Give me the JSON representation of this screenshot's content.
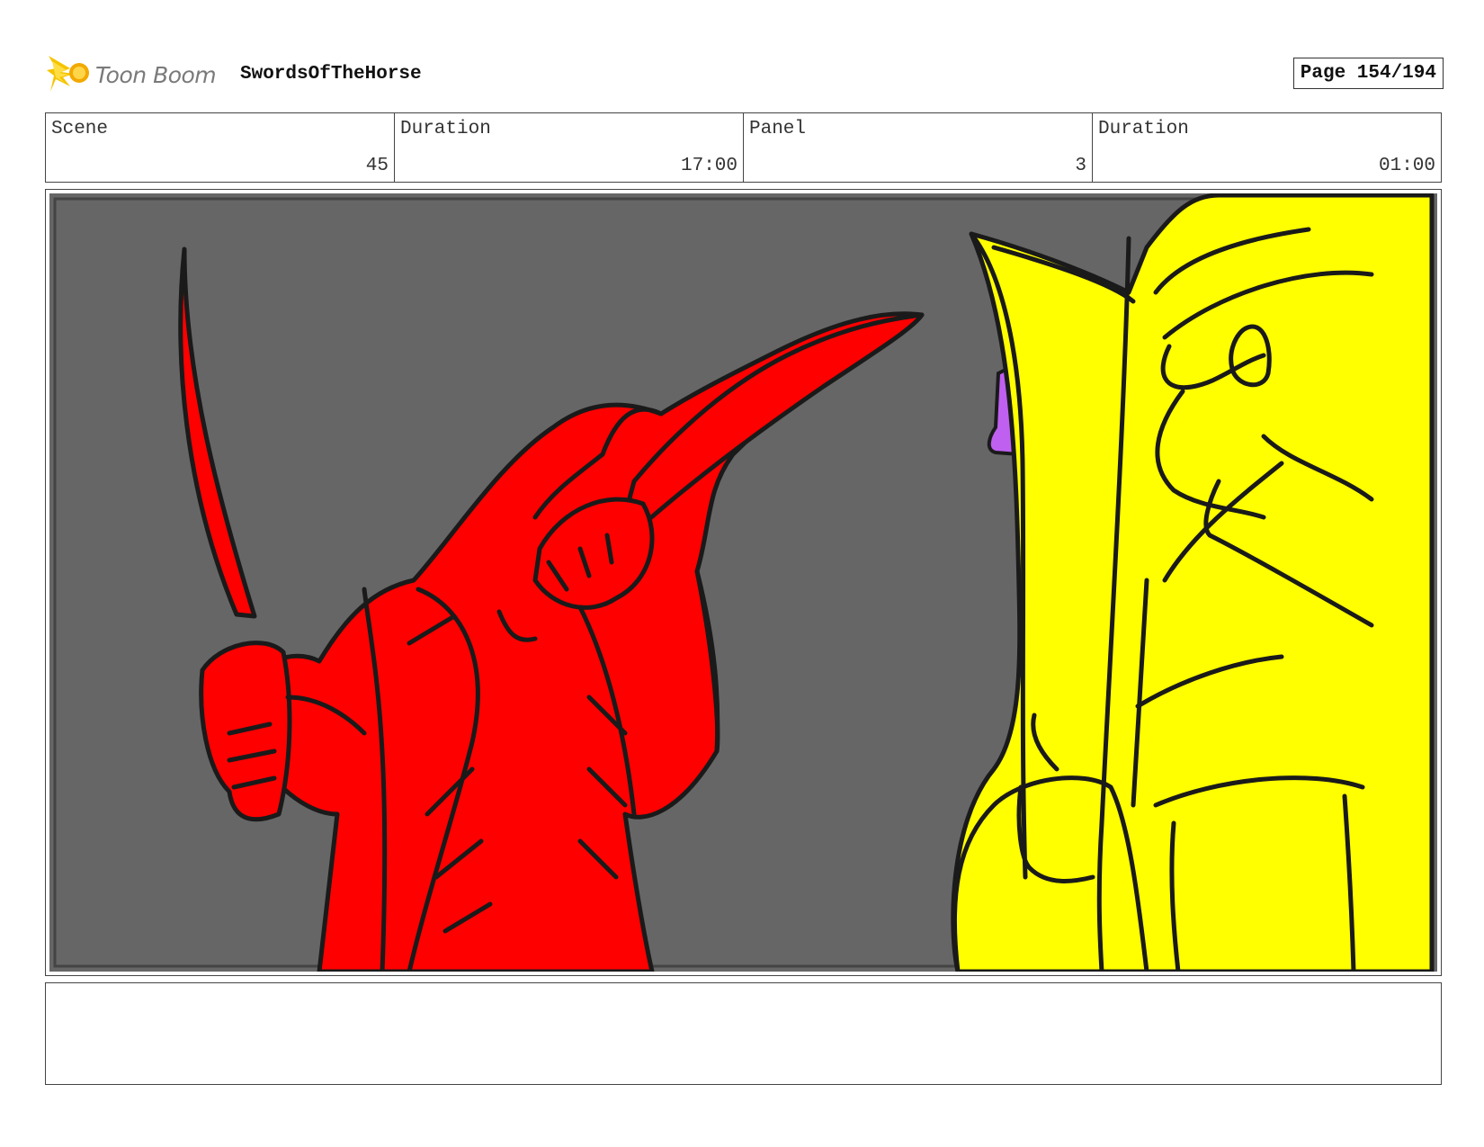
{
  "header": {
    "logo_text": "Toon Boom",
    "project_title": "SwordsOfTheHorse",
    "page_label": "Page 154/194"
  },
  "info": {
    "scene_label": "Scene",
    "scene_value": "45",
    "scene_duration_label": "Duration",
    "scene_duration_value": "17:00",
    "panel_label": "Panel",
    "panel_value": "3",
    "panel_duration_label": "Duration",
    "panel_duration_value": "01:00"
  },
  "colors": {
    "background": "#666666",
    "red_figure": "#ff0000",
    "yellow_figure": "#ffff00",
    "accent_purple": "#c060f0",
    "logo_burst": "#f5c400",
    "line": "#1a1a1a"
  },
  "icons": [
    "toon-boom-logo-icon"
  ]
}
